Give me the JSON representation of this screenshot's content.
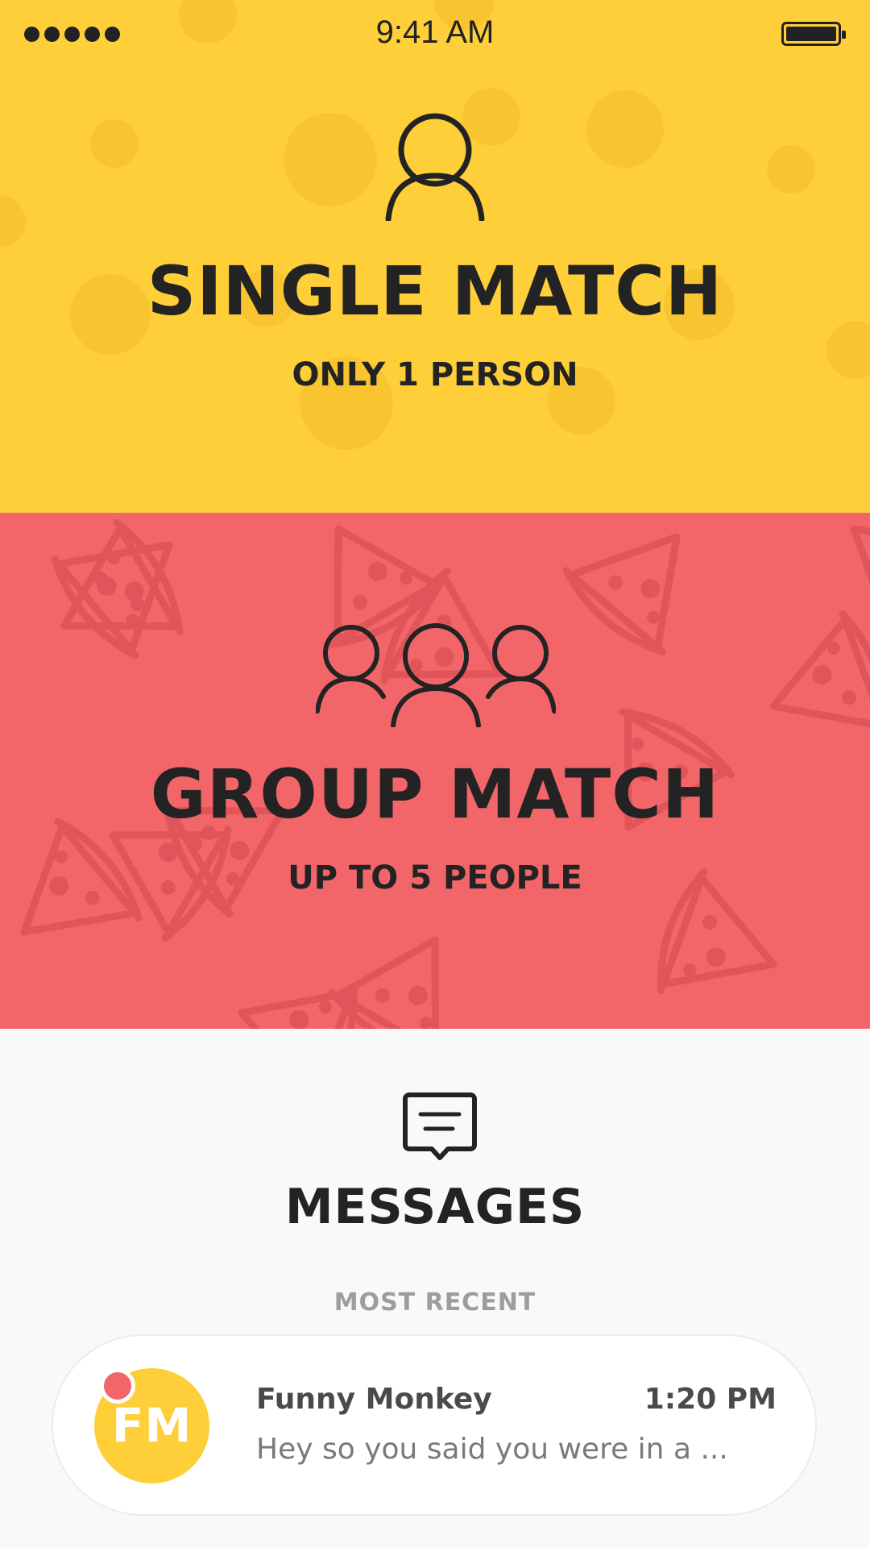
{
  "status_bar": {
    "time": "9:41 AM"
  },
  "single_match": {
    "title": "SINGLE MATCH",
    "subtitle": "ONLY 1 PERSON",
    "icon": "person-icon",
    "background": "#fecf39"
  },
  "group_match": {
    "title": "GROUP MATCH",
    "subtitle": "UP TO 5 PEOPLE",
    "icon": "group-icon",
    "background": "#f26669"
  },
  "messages": {
    "title": "MESSAGES",
    "icon": "message-icon",
    "section_label": "MOST RECENT",
    "recent": [
      {
        "initials": "FM",
        "name": "Funny Monkey",
        "time": "1:20 PM",
        "preview": "Hey so you said you were in a ...",
        "unread": true
      }
    ]
  }
}
